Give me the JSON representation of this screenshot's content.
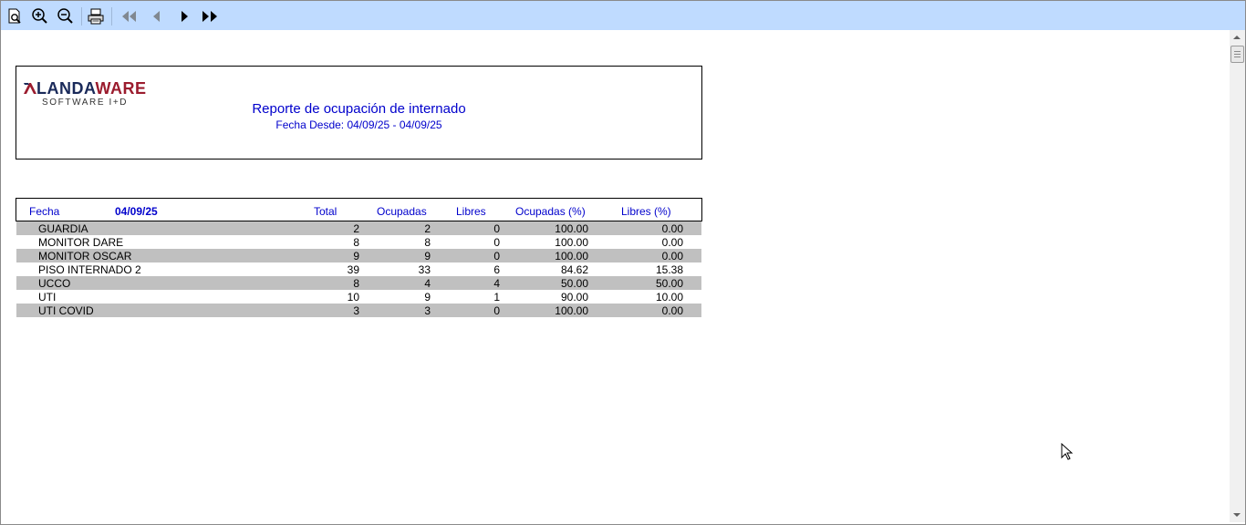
{
  "toolbar": {
    "buttons": [
      {
        "name": "preview-icon"
      },
      {
        "name": "zoom-in-icon"
      },
      {
        "name": "zoom-out-icon"
      },
      {
        "name": "print-icon"
      },
      {
        "name": "first-page-icon"
      },
      {
        "name": "previous-page-icon"
      },
      {
        "name": "next-page-icon"
      },
      {
        "name": "last-page-icon"
      }
    ]
  },
  "logo": {
    "word": "LANDAWARE",
    "sub": "SOFTWARE I+D",
    "color": "#9b1c2e"
  },
  "report": {
    "title": "Reporte de ocupación de internado",
    "subtitle": "Fecha Desde: 04/09/25 - 04/09/25"
  },
  "table": {
    "headers": {
      "fecha": "Fecha",
      "date": "04/09/25",
      "total": "Total",
      "ocupadas": "Ocupadas",
      "libres": "Libres",
      "ocupadas_pct": "Ocupadas (%)",
      "libres_pct": "Libres (%)"
    },
    "rows": [
      {
        "name": "GUARDIA",
        "total": "2",
        "ocupadas": "2",
        "libres": "0",
        "ocupadas_pct": "100.00",
        "libres_pct": "0.00"
      },
      {
        "name": "MONITOR DARE",
        "total": "8",
        "ocupadas": "8",
        "libres": "0",
        "ocupadas_pct": "100.00",
        "libres_pct": "0.00"
      },
      {
        "name": "MONITOR OSCAR",
        "total": "9",
        "ocupadas": "9",
        "libres": "0",
        "ocupadas_pct": "100.00",
        "libres_pct": "0.00"
      },
      {
        "name": "PISO INTERNADO 2",
        "total": "39",
        "ocupadas": "33",
        "libres": "6",
        "ocupadas_pct": "84.62",
        "libres_pct": "15.38"
      },
      {
        "name": "UCCO",
        "total": "8",
        "ocupadas": "4",
        "libres": "4",
        "ocupadas_pct": "50.00",
        "libres_pct": "50.00"
      },
      {
        "name": "UTI",
        "total": "10",
        "ocupadas": "9",
        "libres": "1",
        "ocupadas_pct": "90.00",
        "libres_pct": "10.00"
      },
      {
        "name": "UTI COVID",
        "total": "3",
        "ocupadas": "3",
        "libres": "0",
        "ocupadas_pct": "100.00",
        "libres_pct": "0.00"
      }
    ]
  },
  "colors": {
    "toolbar_bg": "#bfdbff",
    "header_text": "#0000cc",
    "row_shade": "#c0c0c0"
  }
}
